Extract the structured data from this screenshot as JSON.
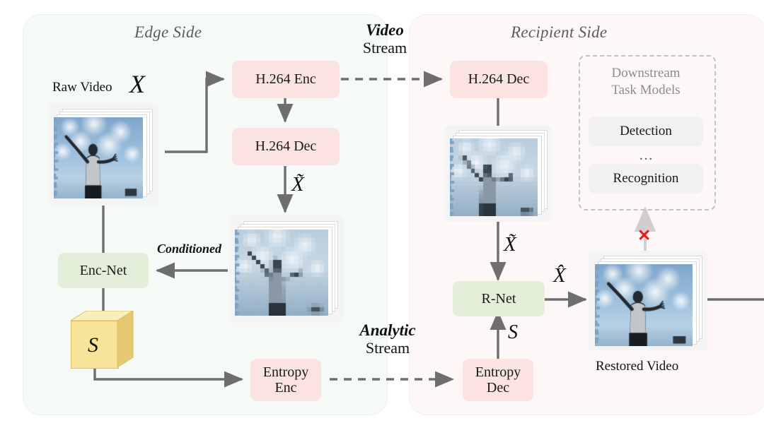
{
  "figure": {
    "type": "architecture-diagram",
    "topic": "Video coding for machines: edge-side encoding with analytic stream and recipient-side restoration"
  },
  "panels": {
    "edge": {
      "title": "Edge Side",
      "bg_color": "#f6faf7"
    },
    "recipient": {
      "title": "Recipient Side",
      "bg_color": "#fdf7f7"
    }
  },
  "colors": {
    "pink_box": "#fbe3e1",
    "green_box": "#e2eed8",
    "gray_box": "#f1f1f1",
    "cube_front": "#f7e39a",
    "cube_top": "#fbeebd",
    "cube_side": "#e3c45f",
    "arrow": "#6e6e6e",
    "arrow_light": "#cfcfcf",
    "red_x": "#e8191b",
    "dashed_border": "#c2c2c2"
  },
  "edge": {
    "raw_video_label": "Raw Video",
    "raw_video_symbol": "X",
    "h264_enc": "H.264 Enc",
    "h264_dec": "H.264 Dec",
    "x_tilde": "X̃",
    "conditioned_label": "Conditioned",
    "enc_net": "Enc-Net",
    "cube_symbol": "S",
    "entropy_enc_line1": "Entropy",
    "entropy_enc_line2": "Enc"
  },
  "recipient": {
    "h264_dec": "H.264 Dec",
    "x_tilde": "X̃",
    "r_net": "R-Net",
    "s_symbol": "S",
    "x_hat": "X̂",
    "entropy_dec_line1": "Entropy",
    "entropy_dec_line2": "Dec",
    "restored_video_label": "Restored Video"
  },
  "downstream": {
    "title_line1": "Downstream",
    "title_line2": "Task Models",
    "tasks": [
      "Detection",
      "Recognition"
    ],
    "ellipsis": "…",
    "blocked_marker": "✕"
  },
  "streams": [
    {
      "emphasis": "Video",
      "rest": "Stream"
    },
    {
      "emphasis": "Analytic",
      "rest": "Stream"
    }
  ]
}
